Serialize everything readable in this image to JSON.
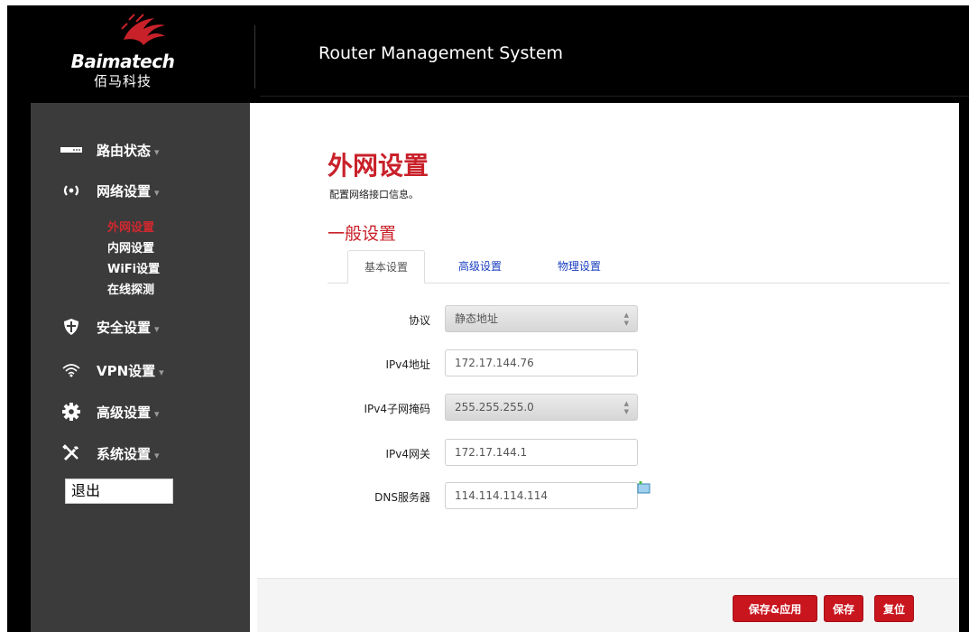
{
  "header": {
    "logo_text": "Baimatech",
    "logo_cn": "佰马科技",
    "title": "Router Management System"
  },
  "sidebar": {
    "items": [
      {
        "label": "路由状态",
        "icon": "router-status-icon"
      },
      {
        "label": "网络设置",
        "icon": "network-signal-icon"
      },
      {
        "label": "安全设置",
        "icon": "shield-icon"
      },
      {
        "label": "VPN设置",
        "icon": "vpn-wifi-icon"
      },
      {
        "label": "高级设置",
        "icon": "gear-icon"
      },
      {
        "label": "系统设置",
        "icon": "tools-icon"
      }
    ],
    "caret": "▾",
    "sub_items": [
      {
        "label": "外网设置",
        "active": true
      },
      {
        "label": "内网设置"
      },
      {
        "label": "WiFi设置"
      },
      {
        "label": "在线探测"
      }
    ],
    "logout": "退出"
  },
  "main": {
    "title": "外网设置",
    "description": "配置网络接口信息。",
    "section_title": "一般设置",
    "tabs": [
      {
        "label": "基本设置",
        "active": true
      },
      {
        "label": "高级设置"
      },
      {
        "label": "物理设置"
      }
    ],
    "fields": {
      "protocol": {
        "label": "协议",
        "value": "静态地址"
      },
      "ipv4_address": {
        "label": "IPv4地址",
        "value": "172.17.144.76"
      },
      "ipv4_netmask": {
        "label": "IPv4子网掩码",
        "value": "255.255.255.0"
      },
      "ipv4_gateway": {
        "label": "IPv4网关",
        "value": "172.17.144.1"
      },
      "dns": {
        "label": "DNS服务器",
        "value": "114.114.114.114"
      }
    }
  },
  "footer": {
    "save_apply": "保存&应用",
    "save": "保存",
    "reset": "复位"
  },
  "colors": {
    "accent": "#c9212a",
    "sidebar_bg": "#3b3b3b",
    "link": "#1a3fbf"
  }
}
